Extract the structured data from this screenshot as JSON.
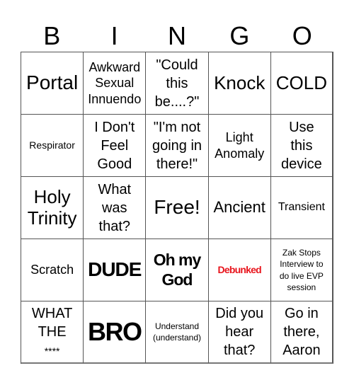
{
  "header": {
    "letters": [
      "B",
      "I",
      "N",
      "G",
      "O"
    ]
  },
  "colors": {
    "text": "#000000",
    "debunked": "#e8141c",
    "grid_line": "#555555",
    "background": "#ffffff"
  },
  "board": {
    "cells": [
      {
        "lines": [
          "Portal"
        ]
      },
      {
        "lines": [
          "Awkward",
          "Sexual",
          "Innuendo"
        ]
      },
      {
        "lines": [
          "\"Could",
          "this",
          "be....?\""
        ]
      },
      {
        "lines": [
          "Knock"
        ]
      },
      {
        "lines": [
          "COLD"
        ]
      },
      {
        "lines": [
          "Respirator"
        ]
      },
      {
        "lines": [
          "I Don't",
          "Feel",
          "Good"
        ]
      },
      {
        "lines": [
          "\"I'm not",
          "going in",
          "there!\""
        ]
      },
      {
        "lines": [
          "Light",
          "Anomaly"
        ]
      },
      {
        "lines": [
          "Use",
          "this",
          "device"
        ]
      },
      {
        "lines": [
          "Holy",
          "Trinity"
        ]
      },
      {
        "lines": [
          "What",
          "was",
          "that?"
        ]
      },
      {
        "lines": [
          "Free!"
        ],
        "free_space": true
      },
      {
        "lines": [
          "Ancient"
        ]
      },
      {
        "lines": [
          "Transient"
        ]
      },
      {
        "lines": [
          "Scratch"
        ]
      },
      {
        "lines": [
          "DUDE"
        ]
      },
      {
        "lines": [
          "Oh my",
          "God"
        ]
      },
      {
        "lines": [
          "Debunked"
        ]
      },
      {
        "lines": [
          "Zak Stops",
          "Interview to",
          "do live EVP",
          "session"
        ]
      },
      {
        "lines": [
          "WHAT",
          "THE",
          "****"
        ]
      },
      {
        "lines": [
          "BRO"
        ]
      },
      {
        "lines": [
          "Understand",
          "(understand)"
        ]
      },
      {
        "lines": [
          "Did you",
          "hear",
          "that?"
        ]
      },
      {
        "lines": [
          "Go in",
          "there,",
          "Aaron"
        ]
      }
    ]
  }
}
